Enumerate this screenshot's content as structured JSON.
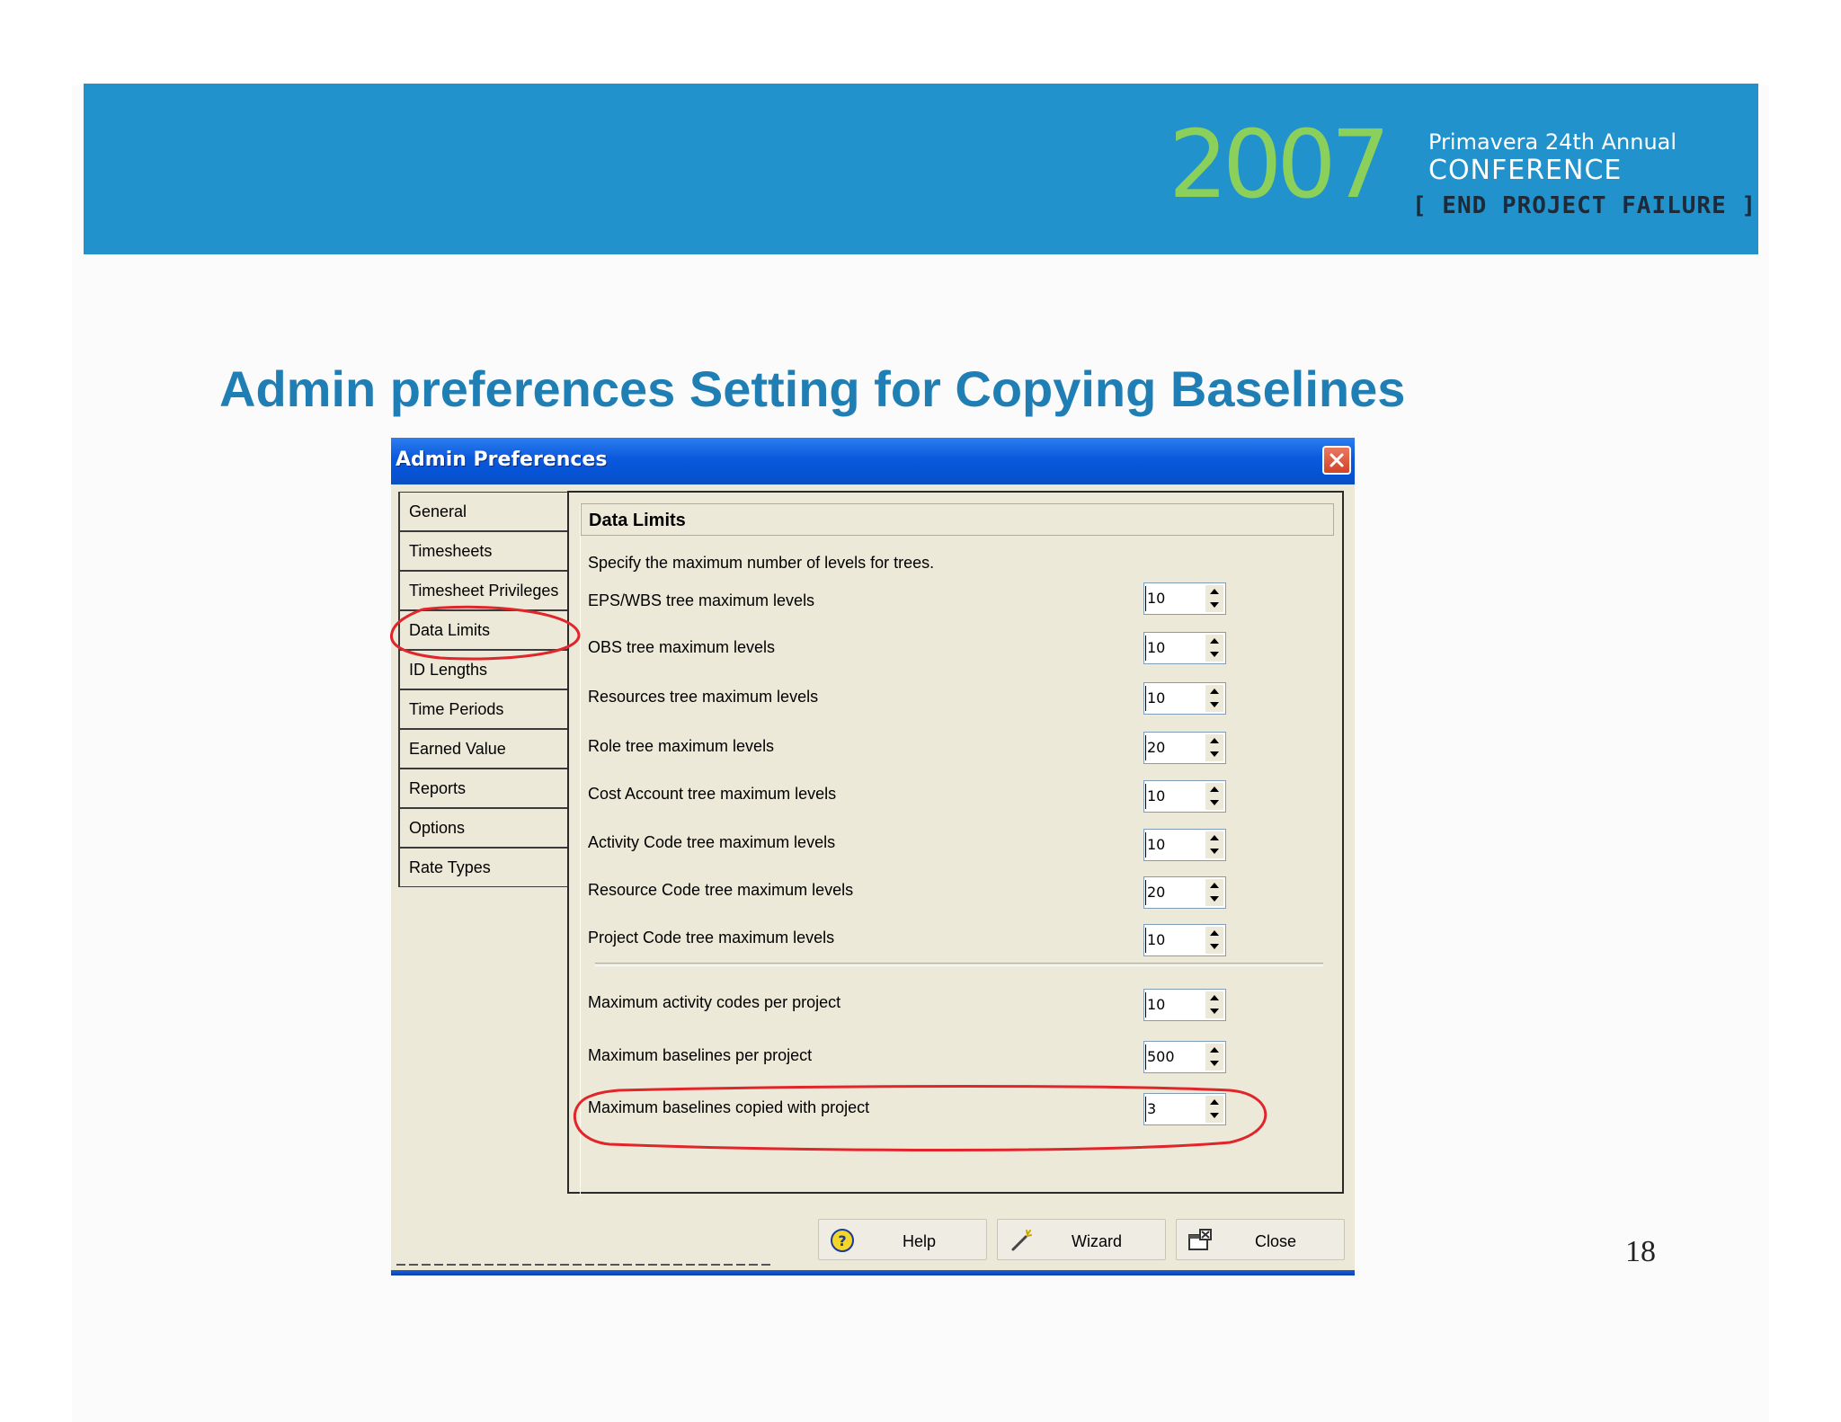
{
  "banner": {
    "year": "2007",
    "line1": "Primavera 24th Annual",
    "line2": "CONFERENCE",
    "tagline": "[ END PROJECT FAILURE ]"
  },
  "slide": {
    "title": "Admin preferences Setting for Copying Baselines",
    "page_number": "18"
  },
  "colors": {
    "banner": "#2192cc",
    "title": "#1f7fb4",
    "logo_year": "#8bd05a",
    "annotation": "#e0262b",
    "titlebar": "#0553d3"
  },
  "dialog": {
    "title": "Admin Preferences",
    "close_icon": "close-icon",
    "nav": [
      {
        "label": "General",
        "active": false
      },
      {
        "label": "Timesheets",
        "active": false
      },
      {
        "label": "Timesheet Privileges",
        "active": false
      },
      {
        "label": "Data Limits",
        "active": true
      },
      {
        "label": "ID Lengths",
        "active": false
      },
      {
        "label": "Time Periods",
        "active": false
      },
      {
        "label": "Earned Value",
        "active": false
      },
      {
        "label": "Reports",
        "active": false
      },
      {
        "label": "Options",
        "active": false
      },
      {
        "label": "Rate Types",
        "active": false
      }
    ],
    "panel": {
      "header": "Data Limits",
      "instruction": "Specify the maximum number of levels for trees.",
      "tree_limits": [
        {
          "label": "EPS/WBS tree maximum levels",
          "value": "10"
        },
        {
          "label": "OBS tree maximum levels",
          "value": "10"
        },
        {
          "label": "Resources tree maximum levels",
          "value": "10"
        },
        {
          "label": "Role tree maximum levels",
          "value": "20"
        },
        {
          "label": "Cost Account tree maximum levels",
          "value": "10"
        },
        {
          "label": "Activity Code tree maximum levels",
          "value": "10"
        },
        {
          "label": "Resource Code tree maximum levels",
          "value": "20"
        },
        {
          "label": "Project Code tree maximum levels",
          "value": "10"
        }
      ],
      "project_limits": [
        {
          "label": "Maximum activity codes per project",
          "value": "10"
        },
        {
          "label": "Maximum baselines per project",
          "value": "500"
        },
        {
          "label": "Maximum baselines copied with project",
          "value": "3"
        }
      ]
    },
    "buttons": [
      {
        "label": "Help",
        "icon": "help-icon"
      },
      {
        "label": "Wizard",
        "icon": "wizard-wand-icon"
      },
      {
        "label": "Close",
        "icon": "close-window-icon"
      }
    ]
  }
}
